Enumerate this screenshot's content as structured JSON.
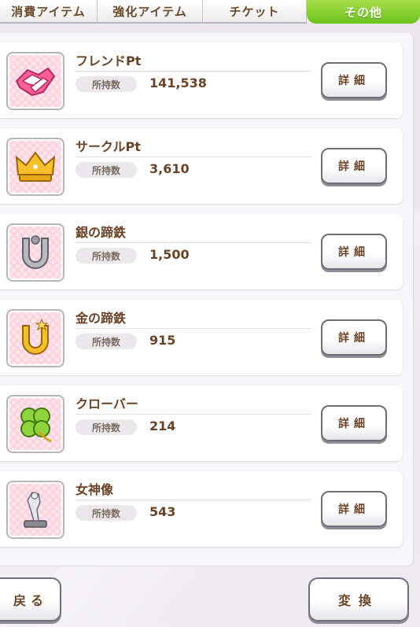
{
  "tabs": [
    {
      "label": "消費アイテム",
      "active": false
    },
    {
      "label": "強化アイテム",
      "active": false
    },
    {
      "label": "チケット",
      "active": false
    },
    {
      "label": "その他",
      "active": true
    }
  ],
  "qty_label": "所持数",
  "detail_label": "詳細",
  "items": [
    {
      "name": "フレンドPt",
      "quantity": "141,538",
      "icon": "handshake-icon"
    },
    {
      "name": "サークルPt",
      "quantity": "3,610",
      "icon": "crown-icon"
    },
    {
      "name": "銀の蹄鉄",
      "quantity": "1,500",
      "icon": "silver-horseshoe-icon"
    },
    {
      "name": "金の蹄鉄",
      "quantity": "915",
      "icon": "gold-horseshoe-icon"
    },
    {
      "name": "クローバー",
      "quantity": "214",
      "icon": "clover-icon"
    },
    {
      "name": "女神像",
      "quantity": "543",
      "icon": "goddess-statue-icon"
    }
  ],
  "footer": {
    "back_label": "戻る",
    "convert_label": "変換"
  },
  "colors": {
    "active_tab": "#7ccb23",
    "text_brown": "#6a4326",
    "icon_bg": "#ffd3df"
  }
}
